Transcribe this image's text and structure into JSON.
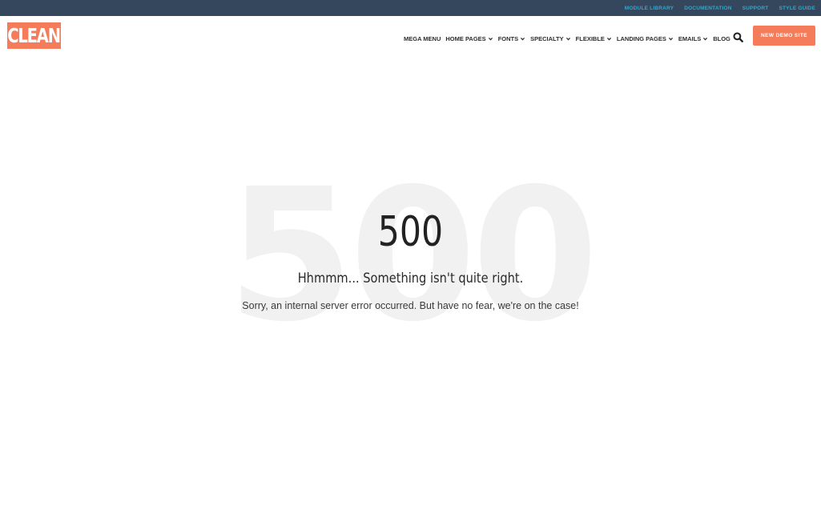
{
  "topbar": {
    "links": [
      "MODULE LIBRARY",
      "DOCUMENTATION",
      "SUPPORT",
      "STYLE GUIDE"
    ]
  },
  "header": {
    "logo_text": "CLEAN",
    "nav": [
      {
        "label": "MEGA MENU",
        "has_dropdown": false
      },
      {
        "label": "HOME PAGES",
        "has_dropdown": true
      },
      {
        "label": "FONTS",
        "has_dropdown": true
      },
      {
        "label": "SPECIALTY",
        "has_dropdown": true
      },
      {
        "label": "FLEXIBLE",
        "has_dropdown": true
      },
      {
        "label": "LANDING PAGES",
        "has_dropdown": true
      },
      {
        "label": "EMAILS",
        "has_dropdown": true
      },
      {
        "label": "BLOG",
        "has_dropdown": false
      }
    ],
    "search_icon": "search-icon",
    "cta_label": "NEW DEMO SITE"
  },
  "error": {
    "background_code": "500",
    "code": "500",
    "headline": "Hhmmm... Something isn't quite right.",
    "message": "Sorry, an internal server error occurred. But have no fear, we're on the case!"
  },
  "colors": {
    "topbar_bg": "#35475c",
    "topbar_link": "#2fa9cf",
    "accent": "#f47c5a",
    "bg_numeral": "#f1f1f1"
  }
}
